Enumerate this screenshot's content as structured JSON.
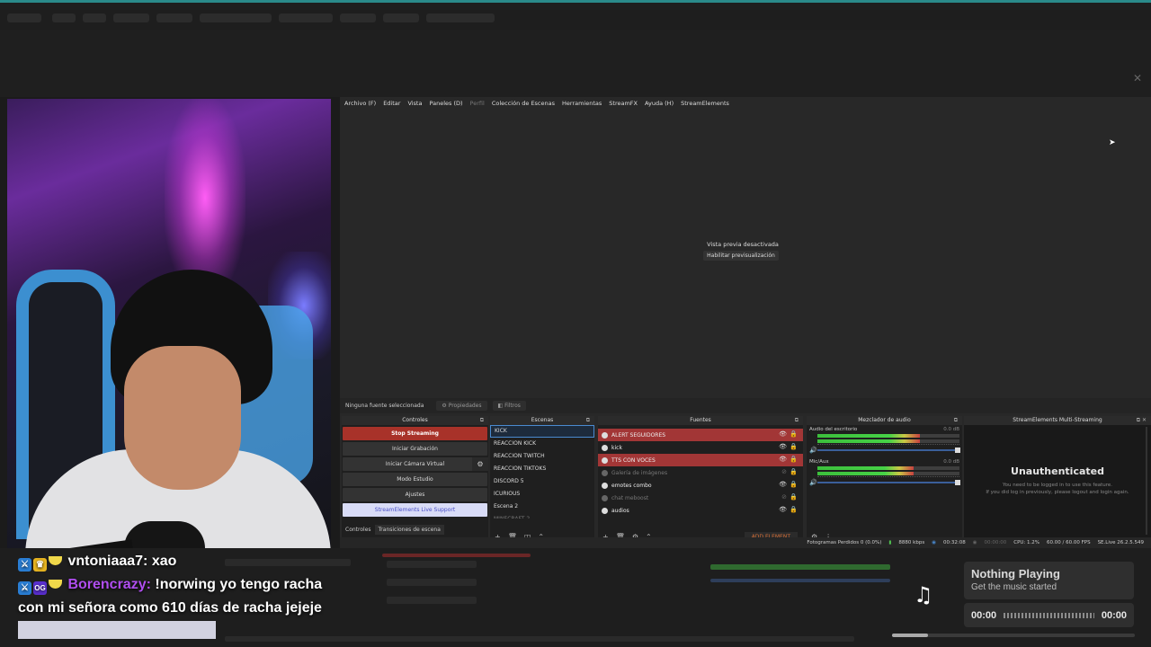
{
  "obs": {
    "menu": [
      "Archivo (F)",
      "Editar",
      "Vista",
      "Paneles (D)",
      "Perfil",
      "Colección de Escenas",
      "Herramientas",
      "StreamFX",
      "Ayuda (H)",
      "StreamElements"
    ],
    "preview": {
      "message": "Vista previa desactivada",
      "enable_button": "Habilitar previsualización"
    },
    "context": {
      "no_source": "Ninguna fuente seleccionada",
      "properties": "Propiedades",
      "filters": "Filtros"
    },
    "controls": {
      "title": "Controles",
      "stop_streaming": "Stop Streaming",
      "start_recording": "Iniciar Grabación",
      "virtual_camera": "Iniciar Cámara Virtual",
      "studio_mode": "Modo Estudio",
      "settings": "Ajustes",
      "live_support": "StreamElements Live Support",
      "tab_controls": "Controles",
      "tab_transitions": "Transiciones de escena"
    },
    "scenes": {
      "title": "Escenas",
      "items": [
        "KICK",
        "REACCION KICK",
        "REACCION TWITCH",
        "REACCION TIKTOKS",
        "DISCORD 5",
        "ICURIOUS",
        "Escena 2",
        "MINECRAFT 2"
      ]
    },
    "sources": {
      "title": "Fuentes",
      "items": [
        {
          "name": "ALERT SEGUIDORES"
        },
        {
          "name": "kick"
        },
        {
          "name": "TTS CON VOCES"
        },
        {
          "name": "Galería de imágenes"
        },
        {
          "name": "emotes combo"
        },
        {
          "name": "chat meboost"
        },
        {
          "name": "audios"
        }
      ],
      "add_element": "ADD ELEMENT"
    },
    "mixer": {
      "title": "Mezclador de audio",
      "channels": [
        {
          "name": "Audio del escritorio",
          "db": "0.0 dB",
          "level": 0.72
        },
        {
          "name": "Mic/Aux",
          "db": "0.0 dB",
          "level": 0.68
        }
      ]
    },
    "se_multi": {
      "title": "StreamElements Multi-Streaming",
      "heading": "Unauthenticated",
      "line1": "You need to be logged in to use this feature.",
      "line2": "If you did log in previously, please logout and login again."
    },
    "status": {
      "dropped": "Fotogramas Perdidos 0 (0.0%)",
      "bitrate": "8880 kbps",
      "live_time": "00:32:08",
      "rec_time": "00:00:00",
      "cpu": "CPU: 1.2%",
      "fps": "60.00 / 60.00 FPS",
      "version": "SE.Live 26.2.5.549"
    }
  },
  "chat": {
    "messages": [
      {
        "user": "vntoniaaa7:",
        "text": " xao"
      },
      {
        "user": "Borencrazy:",
        "text": " !norwing yo tengo racha con mi señora como 610 días de racha jejeje"
      }
    ]
  },
  "music": {
    "title": "Nothing Playing",
    "subtitle": "Get the music started",
    "time_start": "00:00",
    "time_end": "00:00"
  },
  "colors": {
    "stop_streaming": "#a83229",
    "live_support_bg": "#d9dcf7",
    "source_alert": "#a23636",
    "chat_user_highlight": "#b04ef0",
    "scene_selected_border": "#4a8ad0"
  }
}
